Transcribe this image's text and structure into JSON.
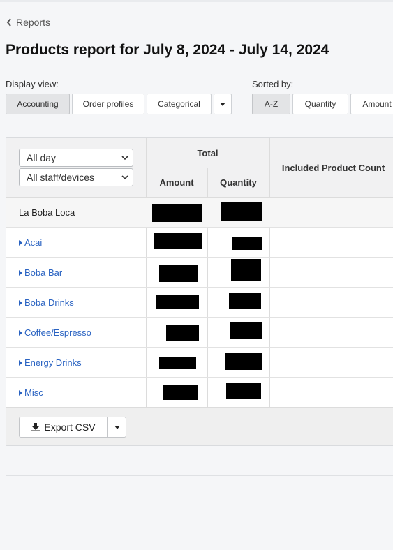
{
  "nav": {
    "back_label": "Reports"
  },
  "page": {
    "title": "Products report for July 8, 2024 - July 14, 2024"
  },
  "display_view": {
    "label": "Display view:",
    "options": [
      "Accounting",
      "Order profiles",
      "Categorical"
    ],
    "selected": "Accounting"
  },
  "sorted_by": {
    "label": "Sorted by:",
    "options": [
      "A-Z",
      "Quantity",
      "Amount"
    ],
    "selected": "A-Z"
  },
  "filters": {
    "time": "All day",
    "staff": "All staff/devices"
  },
  "table": {
    "group_header": "Total",
    "col_amount": "Amount",
    "col_quantity": "Quantity",
    "col_included": "Included Product Count",
    "store_row": "La Boba Loca",
    "categories": [
      "Acai",
      "Boba Bar",
      "Boba Drinks",
      "Coffee/Espresso",
      "Energy Drinks",
      "Misc"
    ]
  },
  "footer": {
    "export_label": "Export CSV"
  },
  "colors": {
    "link": "#2a63c2",
    "active_segment": "#e3e4e6"
  }
}
